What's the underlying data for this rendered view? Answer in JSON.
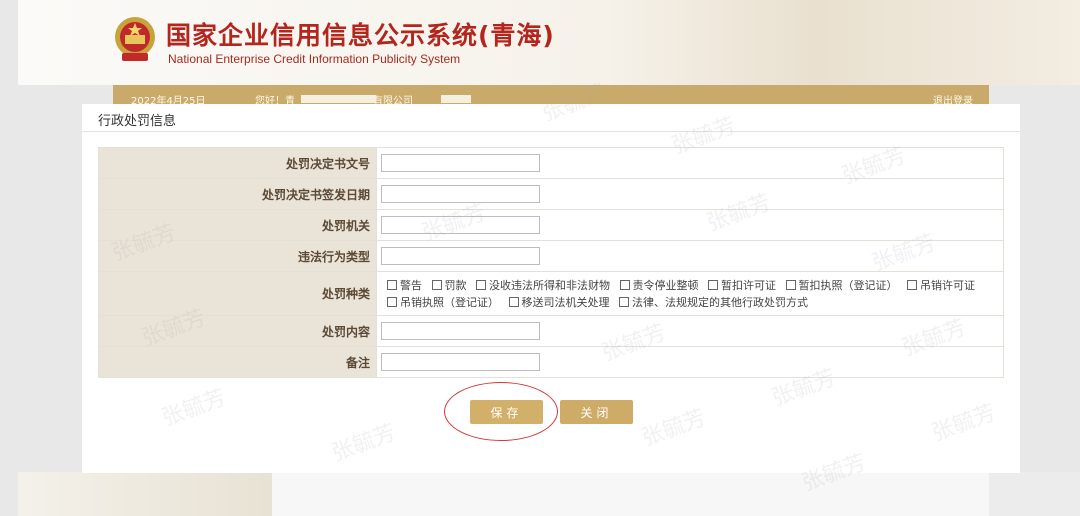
{
  "site": {
    "title": "国家企业信用信息公示系统(青海)",
    "subtitle": "National Enterprise Credit Information Publicity System"
  },
  "nav": {
    "date": "2022年4月25日",
    "greeting": "您好！青",
    "greeting_suffix": "有限公司",
    "logout": "退出登录"
  },
  "dialog": {
    "title": "行政处罚信息",
    "fields": [
      {
        "label": "处罚决定书文号",
        "value": ""
      },
      {
        "label": "处罚决定书签发日期",
        "value": ""
      },
      {
        "label": "处罚机关",
        "value": ""
      },
      {
        "label": "违法行为类型",
        "value": ""
      },
      {
        "label": "处罚种类",
        "options": [
          "警告",
          "罚款",
          "没收违法所得和非法财物",
          "责令停业整顿",
          "暂扣许可证",
          "暂扣执照（登记证）",
          "吊销许可证",
          "吊销执照（登记证）",
          "移送司法机关处理",
          "法律、法规规定的其他行政处罚方式"
        ]
      },
      {
        "label": "处罚内容",
        "value": ""
      },
      {
        "label": "备注",
        "value": ""
      }
    ],
    "buttons": {
      "save": "保存",
      "close": "关闭"
    }
  },
  "watermark": "张毓芳",
  "colors": {
    "accent": "#cfad66",
    "label_bg": "#eae3d8",
    "title_red": "#b3261e",
    "annotation_ring": "#d93636"
  }
}
